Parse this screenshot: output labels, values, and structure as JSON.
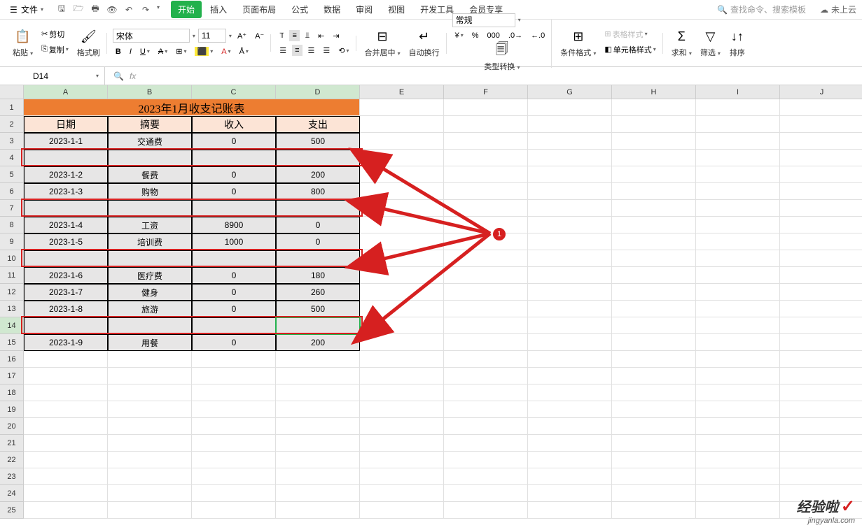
{
  "topbar": {
    "file_label": "文件",
    "tabs": [
      "开始",
      "插入",
      "页面布局",
      "公式",
      "数据",
      "审阅",
      "视图",
      "开发工具",
      "会员专享"
    ],
    "search_placeholder": "查找命令、搜索模板",
    "cloud_label": "未上云"
  },
  "ribbon": {
    "paste_label": "粘贴",
    "cut_label": "剪切",
    "copy_label": "复制",
    "format_painter_label": "格式刷",
    "font_name": "宋体",
    "font_size": "11",
    "merge_label": "合并居中",
    "wrap_label": "自动换行",
    "number_format": "常规",
    "type_convert_label": "类型转换",
    "cond_format_label": "条件格式",
    "table_style_label": "表格样式",
    "cell_style_label": "单元格样式",
    "sum_label": "求和",
    "filter_label": "筛选",
    "sort_label": "排序"
  },
  "formula": {
    "name_box": "D14",
    "fx": "fx"
  },
  "columns": [
    "A",
    "B",
    "C",
    "D",
    "E",
    "F",
    "G",
    "H",
    "I",
    "J"
  ],
  "rows": [
    "1",
    "2",
    "3",
    "4",
    "5",
    "6",
    "7",
    "8",
    "9",
    "10",
    "11",
    "12",
    "13",
    "14",
    "15",
    "16",
    "17",
    "18",
    "19",
    "20",
    "21",
    "22",
    "23",
    "24",
    "25"
  ],
  "table": {
    "title": "2023年1月收支记账表",
    "headers": [
      "日期",
      "摘要",
      "收入",
      "支出"
    ],
    "rows": [
      {
        "date": "2023-1-1",
        "desc": "交通费",
        "in": "0",
        "out": "500"
      },
      {
        "date": "",
        "desc": "",
        "in": "",
        "out": ""
      },
      {
        "date": "2023-1-2",
        "desc": "餐费",
        "in": "0",
        "out": "200"
      },
      {
        "date": "2023-1-3",
        "desc": "购物",
        "in": "0",
        "out": "800"
      },
      {
        "date": "",
        "desc": "",
        "in": "",
        "out": ""
      },
      {
        "date": "2023-1-4",
        "desc": "工资",
        "in": "8900",
        "out": "0"
      },
      {
        "date": "2023-1-5",
        "desc": "培训费",
        "in": "1000",
        "out": "0"
      },
      {
        "date": "",
        "desc": "",
        "in": "",
        "out": ""
      },
      {
        "date": "2023-1-6",
        "desc": "医疗费",
        "in": "0",
        "out": "180"
      },
      {
        "date": "2023-1-7",
        "desc": "健身",
        "in": "0",
        "out": "260"
      },
      {
        "date": "2023-1-8",
        "desc": "旅游",
        "in": "0",
        "out": "500"
      },
      {
        "date": "",
        "desc": "",
        "in": "",
        "out": ""
      },
      {
        "date": "2023-1-9",
        "desc": "用餐",
        "in": "0",
        "out": "200"
      }
    ]
  },
  "annotations": {
    "badge": "1"
  },
  "watermark": {
    "big": "经验啦",
    "small": "jingyanla.com"
  }
}
